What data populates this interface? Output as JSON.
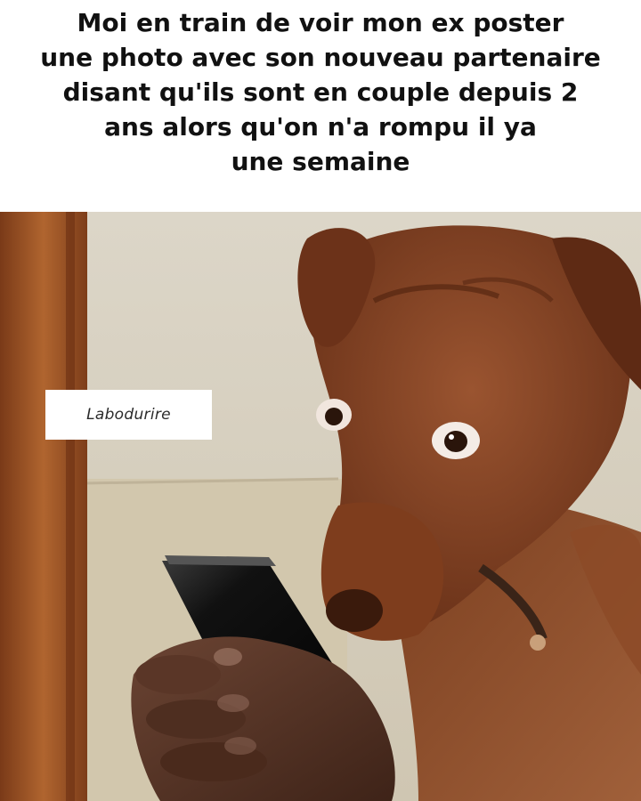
{
  "caption": {
    "lines": [
      "Moi en train de voir mon ex poster",
      "une photo avec son nouveau partenaire",
      "disant qu'ils sont en couple depuis 2",
      "ans alors qu'on n'a rompu il ya",
      "une semaine"
    ]
  },
  "watermark": {
    "text": "Labodurire"
  },
  "photo": {
    "subject": "dog-looking-at-phone",
    "colors": {
      "dog_fur": "#8a4a2a",
      "dog_fur_dark": "#5e2c16",
      "door_wood": "#a0562a",
      "wall": "#d9d2c2",
      "phone": "#151515",
      "hand": "#5a3626"
    }
  }
}
